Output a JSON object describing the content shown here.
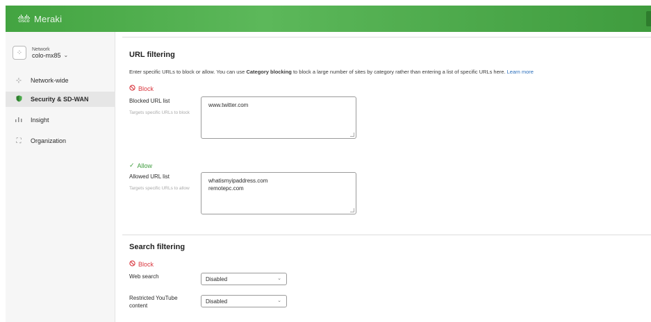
{
  "header": {
    "brand_logo_text": "cisco",
    "brand_name": "Meraki"
  },
  "sidebar": {
    "network_label": "Network",
    "network_name": "colo-mx85",
    "items": [
      {
        "label": "Network-wide",
        "icon": "network-wide-icon",
        "active": false
      },
      {
        "label": "Security & SD-WAN",
        "icon": "shield-icon",
        "active": true
      },
      {
        "label": "Insight",
        "icon": "insight-chart-icon",
        "active": false
      },
      {
        "label": "Organization",
        "icon": "organization-icon",
        "active": false
      }
    ]
  },
  "url_filtering": {
    "title": "URL filtering",
    "desc_pre": "Enter specific URLs to block or allow. You can use ",
    "desc_bold": "Category blocking",
    "desc_post": " to block a large number of sites by category rather than entering a list of specific URLs here. ",
    "desc_link": "Learn more",
    "block_label": "Block",
    "blocked_list_label": "Blocked URL list",
    "blocked_hint": "Targets specific URLs to block",
    "blocked_urls": [
      "www.twitter.com"
    ],
    "allow_label": "Allow",
    "allowed_list_label": "Allowed URL list",
    "allowed_hint": "Targets specific URLs to allow",
    "allowed_urls": [
      "whatismyipaddress.com",
      "remotepc.com"
    ]
  },
  "search_filtering": {
    "title": "Search filtering",
    "block_label": "Block",
    "web_search_label": "Web search",
    "web_search_value": "Disabled",
    "youtube_label": "Restricted YouTube content",
    "youtube_value": "Disabled"
  },
  "colors": {
    "brand_green": "#43a441",
    "block_red": "#d9363e",
    "allow_green": "#3f9c3e",
    "link_blue": "#2a6ebb"
  }
}
